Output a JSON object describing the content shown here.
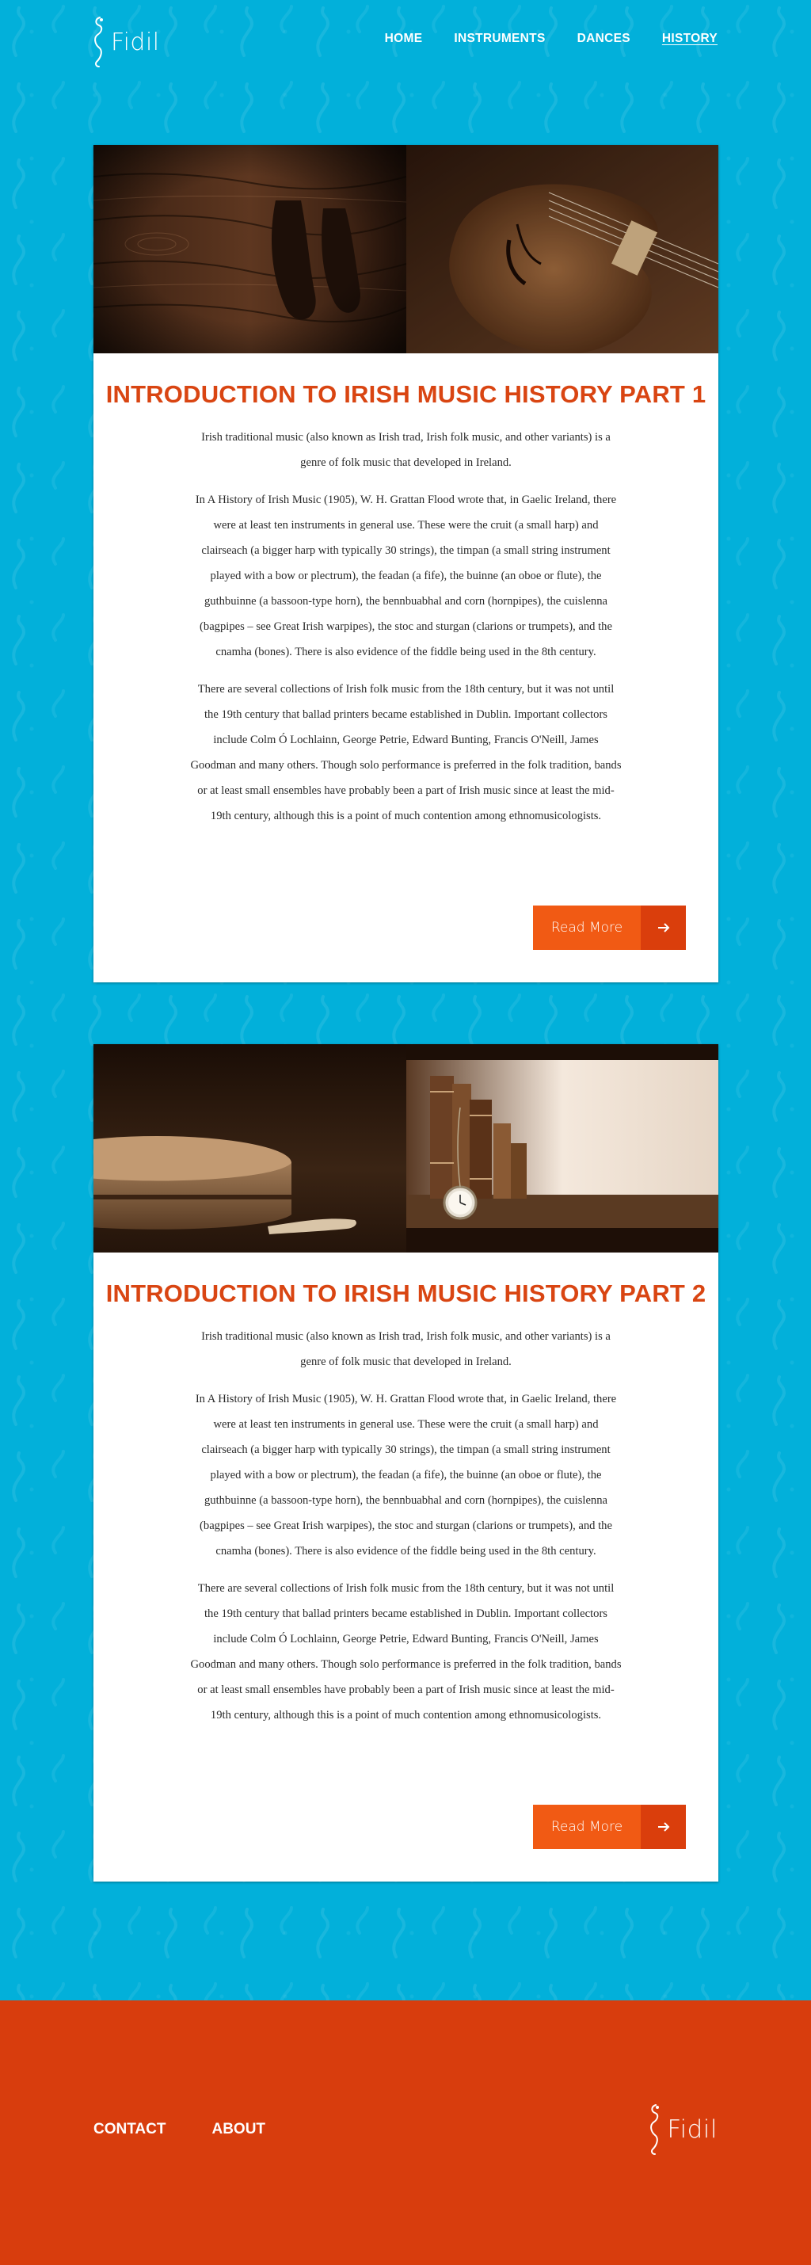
{
  "brand": {
    "name": "Fidil"
  },
  "nav": {
    "items": [
      {
        "label": "HOME"
      },
      {
        "label": "INSTRUMENTS"
      },
      {
        "label": "DANCES"
      },
      {
        "label": "HISTORY"
      }
    ]
  },
  "articles": [
    {
      "title": "INTRODUCTION TO IRISH MUSIC HISTORY PART 1",
      "paragraphs": [
        "Irish traditional music (also known as Irish trad, Irish folk music, and other variants) is a genre of folk music that developed in Ireland.",
        "In A History of Irish Music (1905), W. H. Grattan Flood wrote that, in Gaelic Ireland, there were at least ten instruments in general use. These were the cruit (a small harp) and clairseach (a bigger harp with typically 30 strings), the timpan (a small string instrument played with a bow or plectrum), the feadan (a fife), the buinne (an oboe or flute), the guthbuinne (a bassoon-type horn), the bennbuabhal and corn (hornpipes), the cuislenna (bagpipes – see Great Irish warpipes), the stoc and sturgan (clarions or trumpets), and the cnamha (bones). There is also evidence of the fiddle being used in the 8th century.",
        "There are several collections of Irish folk music from the 18th century, but it was not until the 19th century that ballad printers became established in Dublin. Important collectors include Colm Ó Lochlainn, George Petrie, Edward Bunting, Francis O'Neill, James Goodman and many others. Though solo performance is preferred in the folk tradition, bands or at least small ensembles have probably been a part of Irish music since at least the mid-19th century, although this is a point of much contention among ethnomusicologists."
      ],
      "button_label": "Read More",
      "images": [
        "dance-shoes-on-wood",
        "violin-closeup"
      ]
    },
    {
      "title": "INTRODUCTION TO IRISH MUSIC HISTORY PART 2",
      "paragraphs": [
        "Irish traditional music (also known as Irish trad, Irish folk music, and other variants) is a genre of folk music that developed in Ireland.",
        "In A History of Irish Music (1905), W. H. Grattan Flood wrote that, in Gaelic Ireland, there were at least ten instruments in general use. These were the cruit (a small harp) and clairseach (a bigger harp with typically 30 strings), the timpan (a small string instrument played with a bow or plectrum), the feadan (a fife), the buinne (an oboe or flute), the guthbuinne (a bassoon-type horn), the bennbuabhal and corn (hornpipes), the cuislenna (bagpipes – see Great Irish warpipes), the stoc and sturgan (clarions or trumpets), and the cnamha (bones). There is also evidence of the fiddle being used in the 8th century.",
        "There are several collections of Irish folk music from the 18th century, but it was not until the 19th century that ballad printers became established in Dublin. Important collectors include Colm Ó Lochlainn, George Petrie, Edward Bunting, Francis O'Neill, James Goodman and many others. Though solo performance is preferred in the folk tradition, bands or at least small ensembles have probably been a part of Irish music since at least the mid-19th century, although this is a point of much contention among ethnomusicologists."
      ],
      "button_label": "Read More",
      "images": [
        "bodhran-drum",
        "old-books-and-pocket-watch"
      ]
    }
  ],
  "footer": {
    "links": [
      {
        "label": "CONTACT"
      },
      {
        "label": "ABOUT"
      }
    ],
    "brand": "Fidil"
  },
  "colors": {
    "background": "#02b0da",
    "accent": "#d94512",
    "button": "#f15a14",
    "button_dark": "#da3e0c",
    "footer": "#d83d0d"
  }
}
